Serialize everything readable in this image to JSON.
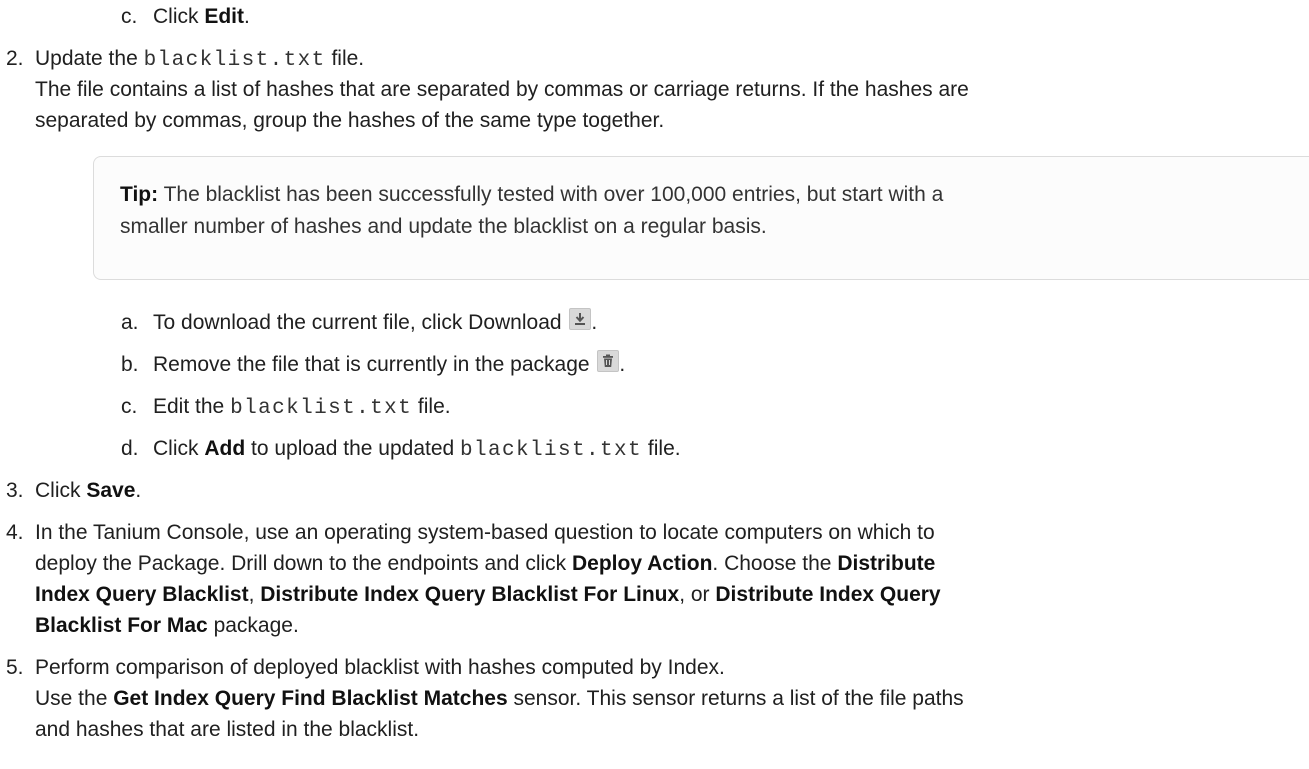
{
  "step1c": {
    "marker": "c.",
    "pre": "Click ",
    "bold": "Edit",
    "post": "."
  },
  "step2": {
    "marker": "2.",
    "pre": "Update the ",
    "code": "blacklist.txt",
    "post": " file.",
    "desc_line1": "The file contains a list of hashes that are separated by commas or carriage returns. If the hashes are",
    "desc_line2": "separated by commas, group the hashes of the same type together."
  },
  "tip": {
    "label": "Tip:",
    "line1": " The blacklist has been successfully tested with over 100,000 entries, but start with a",
    "line2": "smaller number of hashes and update the blacklist on a regular basis."
  },
  "substeps": {
    "a": {
      "marker": "a.",
      "text": "To download the current file, click Download ",
      "post": ".",
      "icon": "download-icon"
    },
    "b": {
      "marker": "b.",
      "text": "Remove the file that is currently in the package ",
      "post": ".",
      "icon": "trash-icon"
    },
    "c": {
      "marker": "c.",
      "pre": "Edit the ",
      "code": "blacklist.txt",
      "post": " file."
    },
    "d": {
      "marker": "d.",
      "pre": "Click ",
      "bold": "Add",
      "mid": " to upload the updated ",
      "code": "blacklist.txt",
      "post": " file."
    }
  },
  "step3": {
    "marker": "3.",
    "pre": "Click ",
    "bold": "Save",
    "post": "."
  },
  "step4": {
    "marker": "4.",
    "line1": "In the Tanium Console, use an operating system-based question to locate computers on which to",
    "line2_pre": "deploy the Package. Drill down to the endpoints and click ",
    "line2_b1": "Deploy Action",
    "line2_mid": ". Choose the ",
    "line2_b2": "Distribute",
    "line3_b1": "Index Query Blacklist",
    "line3_sep1": ", ",
    "line3_b2": "Distribute Index Query Blacklist For Linux",
    "line3_sep2": ", or ",
    "line3_b3": "Distribute Index Query",
    "line4_b1": "Blacklist For Mac",
    "line4_post": " package."
  },
  "step5": {
    "marker": "5.",
    "line1": "Perform comparison of deployed blacklist with hashes computed by Index.",
    "line2_pre": "Use the ",
    "line2_b": "Get Index Query Find Blacklist Matches",
    "line2_post": " sensor. This sensor returns a list of the file paths",
    "line3": "and hashes that are listed in the blacklist."
  },
  "colors": {
    "text": "#202020",
    "tip_border": "#dcdcdc",
    "icon_bg": "#d9d9d9"
  }
}
